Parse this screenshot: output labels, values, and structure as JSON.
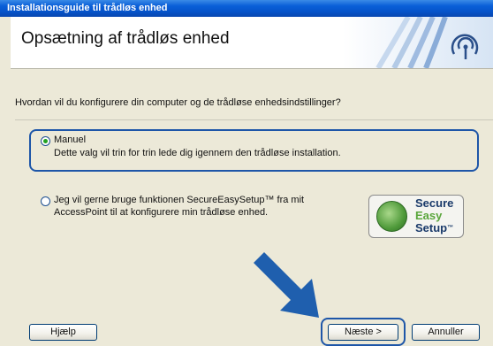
{
  "window": {
    "title": "Installationsguide til trådløs enhed"
  },
  "header": {
    "title": "Opsætning af trådløs enhed"
  },
  "question": "Hvordan vil du konfigurere din computer og de trådløse enhedsindstillinger?",
  "options": [
    {
      "label": "Manuel",
      "description": "Dette valg vil trin for trin lede dig igennem den trådløse installation.",
      "selected": true
    },
    {
      "line1": "Jeg vil gerne bruge funktionen SecureEasySetup™ fra mit",
      "line2": "AccessPoint til at konfigurere min trådløse enhed.",
      "selected": false
    }
  ],
  "secure_logo": {
    "word1": "Secure",
    "word2": "Easy",
    "word3": "Setup",
    "mark": "™"
  },
  "buttons": {
    "help": "Hjælp",
    "next": "Næste >",
    "cancel": "Annuller"
  },
  "colors": {
    "titlebar": "#0a5fd8",
    "highlight": "#1e56a8",
    "arrow": "#1f5fae",
    "radio_selected": "#21a121"
  },
  "icons": {
    "header": "wireless-signal-icon",
    "arrow": "pointing-arrow-icon"
  }
}
